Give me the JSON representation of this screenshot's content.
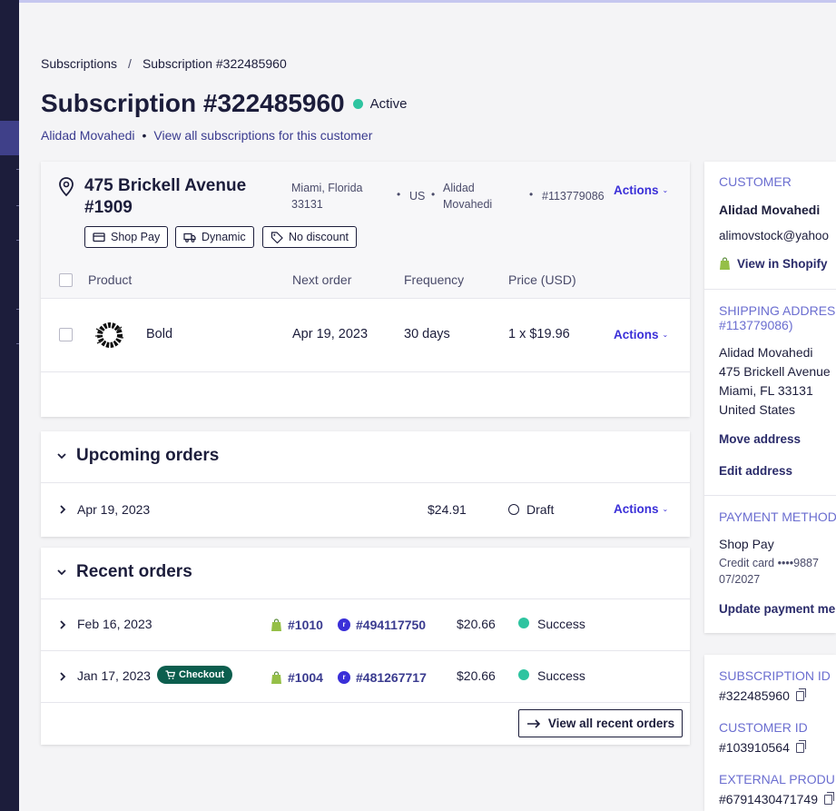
{
  "breadcrumb": {
    "root": "Subscriptions",
    "sep": "/",
    "current": "Subscription #322485960"
  },
  "title": "Subscription #322485960",
  "status": {
    "label": "Active",
    "color": "#2ec4a0"
  },
  "subline": {
    "customer": "Alidad Movahedi",
    "bullet": "•",
    "view_all": "View all subscriptions for this customer"
  },
  "address_card": {
    "street": "475 Brickell Avenue #1909",
    "city_state": "Miami, Florida",
    "zip": "33131",
    "country": "US",
    "name_first": "Alidad",
    "name_last": "Movahedi",
    "address_id": "#113779086",
    "actions": "Actions",
    "bullet": "•",
    "tags": [
      "Shop Pay",
      "Dynamic",
      "No discount"
    ]
  },
  "product_table": {
    "headers": [
      "Product",
      "Next order",
      "Frequency",
      "Price (USD)"
    ],
    "rows": [
      {
        "name": "Bold",
        "next_order": "Apr 19, 2023",
        "frequency": "30 days",
        "price": "1 x $19.96",
        "actions": "Actions"
      }
    ]
  },
  "upcoming": {
    "title": "Upcoming orders",
    "rows": [
      {
        "date": "Apr 19, 2023",
        "amount": "$24.91",
        "status": "Draft",
        "actions": "Actions"
      }
    ]
  },
  "recent": {
    "title": "Recent orders",
    "rows": [
      {
        "date": "Feb 16, 2023",
        "badge": "",
        "shop_order": "#1010",
        "recharge_order": "#494117750",
        "amount": "$20.66",
        "status": "Success"
      },
      {
        "date": "Jan 17, 2023",
        "badge": "Checkout",
        "shop_order": "#1004",
        "recharge_order": "#481267717",
        "amount": "$20.66",
        "status": "Success"
      }
    ],
    "view_all": "View all recent orders"
  },
  "sidebar": {
    "customer_head": "CUSTOMER",
    "customer_name": "Alidad Movahedi",
    "customer_email": "alimovstock@yahoo",
    "view_shopify": "View in Shopify",
    "shipping_head_1": "SHIPPING ADDRESS",
    "shipping_head_2": "#113779086)",
    "ship_lines": [
      "Alidad Movahedi",
      "475 Brickell Avenue",
      "Miami, FL 33131",
      "United States"
    ],
    "move_address": "Move address",
    "edit_address": "Edit address",
    "payment_head": "PAYMENT METHOD",
    "payment_type": "Shop Pay",
    "card_line": "Credit card ••••9887",
    "card_exp": "07/2027",
    "update_payment": "Update payment me",
    "sub_id_head": "SUBSCRIPTION ID",
    "sub_id": "#322485960",
    "cust_id_head": "CUSTOMER ID",
    "cust_id": "#103910564",
    "ext_head": "EXTERNAL PRODU",
    "ext_id": "#6791430471749"
  }
}
